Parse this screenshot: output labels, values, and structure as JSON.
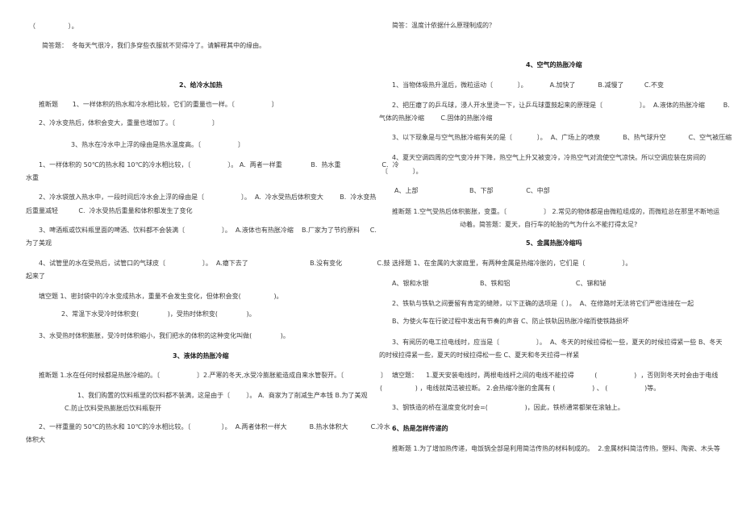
{
  "left": {
    "lines": [
      "（                ）。",
      "简答题：  冬每天气很冷，我们多穿些衣服就不觉得冷了。请解释其中的缘由。",
      "2、给冷水加热",
      "推断题       1、一样体积的热水和冷水相比较，它们的重量也一样。〔                  〕",
      "2、冷水变热后，体积会变大，重量也增加了。〔                  〕",
      "3、热水在冷水中上浮的缘由是热水温度高。〔                  〕",
      "1、一样体积的 50℃的热水和 10℃的冷水相比较，〔                  〕。 A.  两者一样重              B.  热水重                    C.  冷",
      "水重",
      "2、冷水袋放入热水中，一段时间后冷水会上浮的缘由是〔                  〕。  A.  冷水受热后体积变大        B.  冷水变热",
      "后重量减轻          C.  冷水受热后重量和体积都发生了变化",
      "3、啤酒瓶或饮料瓶里面的啤酒、饮料都不会装满〔                  〕。  A.液体也有热胀冷缩    B.厂家为了节约原料     C.",
      "为了美观",
      "4、试管里的水在受热后，试管口的气球皮〔                  〕。  A.瘪下去了                              B.没有变化                 C.鼓",
      "起来了",
      "填空题 1、密封袋中的冷水变成热水，重量不会发生变化，但体积会变(                )。",
      "2、常温下水受冷时体积变(              )，受热时体积变(              )。",
      "3、水受热时体积膨胀，受冷时体积缩小，我们把水的体积的这种变化叫做(              )。",
      "3、液体的热胀冷缩",
      "推断题 1.水在任何时候都是热胀冷缩的。〔                  〕2.严寒的冬天,水受冷膨胀能造成自来水管裂开。〔                  〕",
      "1、我们购置的饮料瓶里的饮料都不装满，这是由于〔        〕。 A.  商家为了削减生产本钱 B.为了美观",
      "C.防止饮料受热膨胀后饮料瓶裂开",
      "2、一样重量的 50℃的热水和 10℃的冷水相比较。〔               〕。  A.两者体积一样大           B.热水体积大           C.冷水",
      "体积大"
    ]
  },
  "right": {
    "lines": [
      "简答：温度计依据什么原理制成的？",
      "4、空气的热胀冷缩",
      "1、当物体吸热升温后，微粒运动〔            〕。           A.加快了           B.减慢了          C.不变",
      "2、把压瘪了的乒乓球，浸人开水里烫一下，让乒乓球重鼓起来的原理是〔                  〕。  A.液体的热胀冷缩         B.",
      "气体的热胀冷缩        C.固体的热胀冷缩",
      "3、以下现象是与空气热胀冷缩有关的是〔            〕。  A、广场上的喷泉           B、热气球升空           C、空气被压缩",
      "4、夏天空调四周的空气变冷并下降，热空气上升又被变冷，冷热空气对流使空气凉快。所以空调应装在房间的",
      "〔            〕。",
      "A、上部                         B、下部                C、中部",
      "推断题 1.空气受热后体积膨胀，变重。〔                  〕 2.常见的物体都是由微粒组成的，而微粒总在那里不断地运",
      "动着。简答题：夏天，自行车的轮胎的气为什么不能打得太足?",
      "5、金属热胀冷缩吗",
      "选择题 1、在金属的大家庭里，有两种金属是热缩冷胀的，它们是〔                  〕。",
      "A、银和水银                         B、铁和铝                                C、锑和铋",
      "2、铁轨与铁轨之间要留有肯定的缝隙，以下正确的选项是〔 〕。  A、在修路时无法将它们严密连接在一起",
      "B、为使火车在行驶过程中发出有节奏的声音 C、防止铁轨因热胀冷缩而使铁路损坏",
      "3、有阅历的电工拉电线时，应当是〔                  〕。  A、冬天的时候拉得松一些，夏天的时候拉得紧一些 B、冬天",
      "的时候拉得紧一些，夏天的时候拉得松一些 C、夏天和冬天拉得一样紧",
      "填空题：    1.夏天安装电线时，两根电线杆之间的电线不能拉得          (                  )  ，否则到冬天时会由于电线",
      "(                ) ，电线就简洁被拉断。 2.会热缩冷胀的金属有 (                  ) 、 (                  )等。",
      "3、钢铁造的桥在温度变化时会=(                  )，因此，铁桥通常都架在滚轴上。",
      "6、热是怎样传递的",
      "推断题 1.为了增加热传递，电饭锅全部是利用简洁传热的材料制成的。  2.金属材料简洁传热，塑料、陶瓷、木头等"
    ]
  }
}
